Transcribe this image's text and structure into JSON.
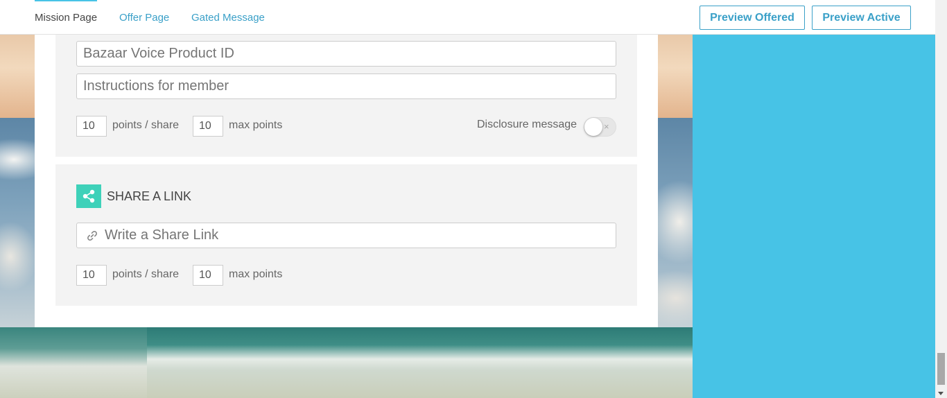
{
  "nav": {
    "tabs": [
      {
        "label": "Mission Page",
        "active": true
      },
      {
        "label": "Offer Page",
        "active": false
      },
      {
        "label": "Gated Message",
        "active": false
      }
    ],
    "preview_offered": "Preview Offered",
    "preview_active": "Preview Active"
  },
  "section1": {
    "bazaar_placeholder": "Bazaar Voice Product ID",
    "instructions_placeholder": "Instructions for member",
    "points_per_share": "10",
    "points_per_share_label": "points / share",
    "max_points": "10",
    "max_points_label": "max points",
    "disclosure_label": "Disclosure message",
    "disclosure_enabled": false,
    "toggle_off_glyph": "×"
  },
  "section2": {
    "icon": "share-icon",
    "title": "SHARE A LINK",
    "share_link_placeholder": "Write a Share Link",
    "points_per_share": "10",
    "points_per_share_label": "points / share",
    "max_points": "10",
    "max_points_label": "max points"
  },
  "colors": {
    "accent": "#3aa0c8",
    "right_panel": "#47c3e6",
    "share_badge": "#3ed1b9"
  }
}
